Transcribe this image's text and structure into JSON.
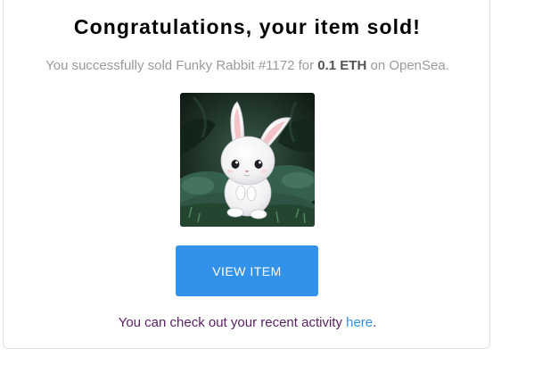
{
  "email": {
    "title": "Congratulations, your item sold!",
    "message": {
      "prefix": "You successfully sold Funky Rabbit #1172 for ",
      "price": "0.1 ETH",
      "suffix": " on OpenSea."
    },
    "image_subject": "white-rabbit-nft",
    "button_label": "VIEW ITEM",
    "activity": {
      "text": "You can check out your recent activity ",
      "link_label": "here",
      "trailing": "."
    }
  },
  "colors": {
    "button": "#3291e9",
    "link": "#3291e9",
    "activity_text": "#5a1f66",
    "muted_text": "#9a9a9a"
  }
}
